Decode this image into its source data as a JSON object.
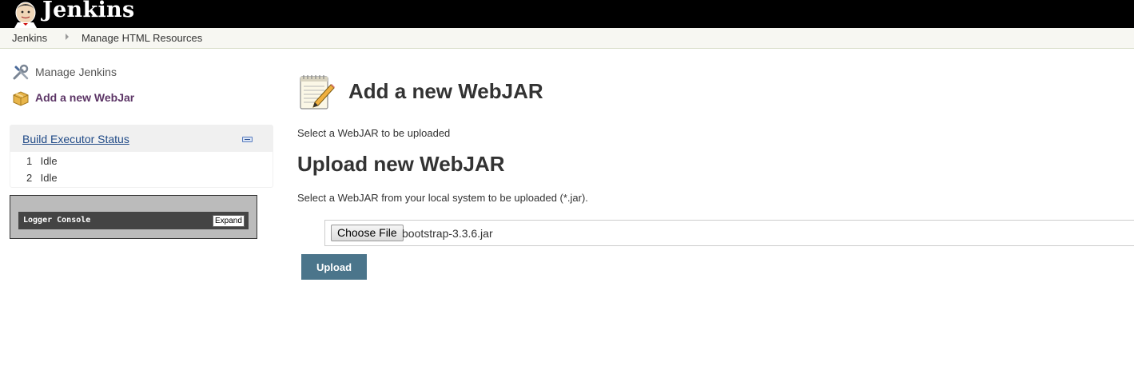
{
  "header": {
    "logo_text": "Jenkins"
  },
  "breadcrumb": {
    "items": [
      "Jenkins",
      "Manage HTML Resources"
    ]
  },
  "side_panel": {
    "tasks": [
      {
        "label": "Manage Jenkins",
        "icon": "wrench-screwdriver-icon"
      },
      {
        "label": "Add a new WebJar",
        "icon": "package-icon"
      }
    ],
    "executors": {
      "title": "Build Executor Status",
      "rows": [
        {
          "number": "1",
          "status": "Idle"
        },
        {
          "number": "2",
          "status": "Idle"
        }
      ]
    },
    "logger": {
      "title": "Logger Console",
      "expand_label": "Expand"
    }
  },
  "main": {
    "title": "Add a new WebJAR",
    "title_icon": "notepad-pencil-icon",
    "intro": "Select a WebJAR to be uploaded",
    "section_title": "Upload new WebJAR",
    "section_desc": "Select a WebJAR from your local system to be uploaded (*.jar).",
    "file_input": {
      "button_label": "Choose File",
      "selected_file": "bootstrap-3.3.6.jar"
    },
    "upload_label": "Upload"
  },
  "colors": {
    "header_bg": "#000000",
    "breadcrumb_bg": "#f7f7f2",
    "link": "#204a87",
    "upload_button": "#4b758b"
  }
}
